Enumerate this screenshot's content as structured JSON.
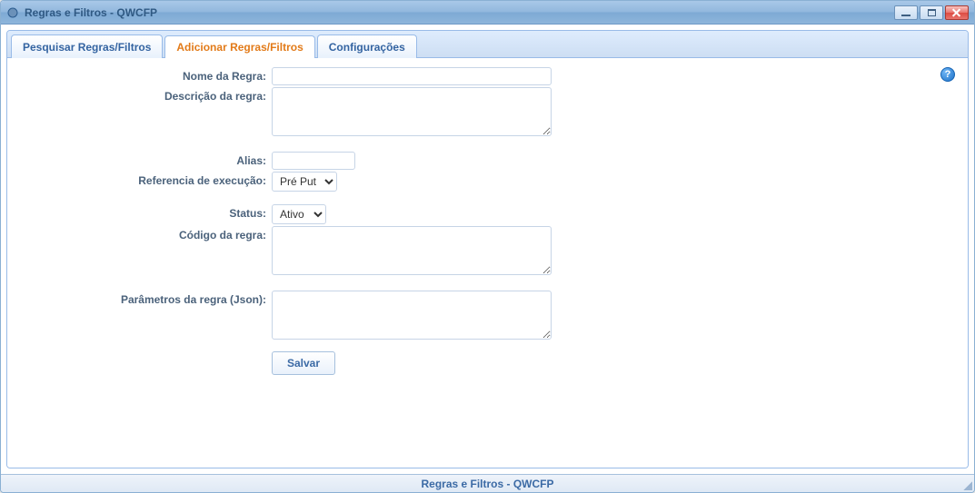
{
  "window": {
    "title": "Regras e Filtros - QWCFP"
  },
  "tabs": [
    {
      "label": "Pesquisar Regras/Filtros",
      "active": false
    },
    {
      "label": "Adicionar Regras/Filtros",
      "active": true
    },
    {
      "label": "Configurações",
      "active": false
    }
  ],
  "form": {
    "nome_label": "Nome da Regra:",
    "nome_value": "",
    "descricao_label": "Descrição da regra:",
    "descricao_value": "",
    "alias_label": "Alias:",
    "alias_value": "",
    "ref_exec_label": "Referencia de execução:",
    "ref_exec_selected": "Pré Put",
    "ref_exec_options": [
      "Pré Put"
    ],
    "status_label": "Status:",
    "status_selected": "Ativo",
    "status_options": [
      "Ativo"
    ],
    "codigo_label": "Código da regra:",
    "codigo_value": "",
    "params_label": "Parâmetros da regra (Json):",
    "params_value": "",
    "save_label": "Salvar"
  },
  "statusbar": {
    "text": "Regras e Filtros - QWCFP"
  },
  "icons": {
    "help": "?"
  }
}
